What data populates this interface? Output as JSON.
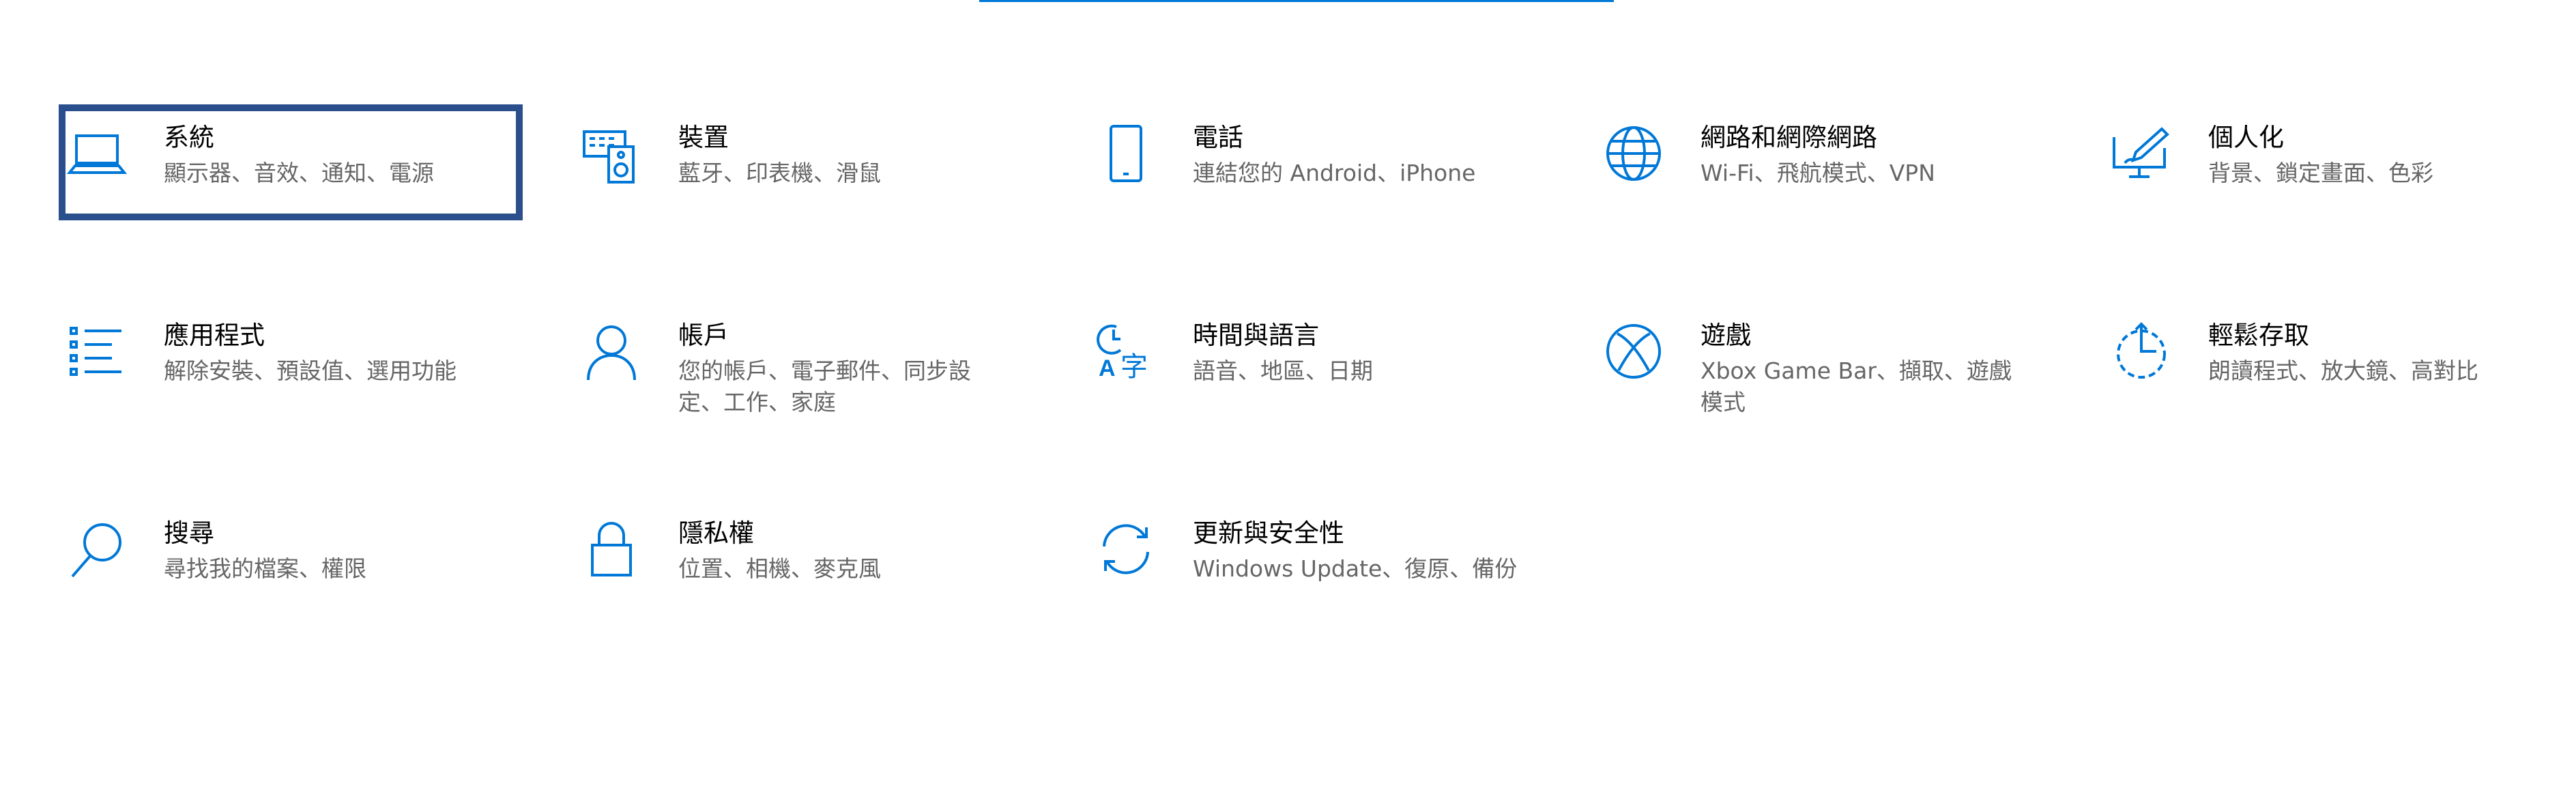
{
  "accent_color": "#0078d7",
  "selected_outline_color": "#2b4f8c",
  "tiles": [
    {
      "title": "系統",
      "desc": "顯示器、音效、通知、電源",
      "icon": "laptop-icon"
    },
    {
      "title": "裝置",
      "desc": "藍牙、印表機、滑鼠",
      "icon": "devices-icon"
    },
    {
      "title": "電話",
      "desc": "連結您的 Android、iPhone",
      "icon": "phone-icon"
    },
    {
      "title": "網路和網際網路",
      "desc": "Wi-Fi、飛航模式、VPN",
      "icon": "globe-icon"
    },
    {
      "title": "個人化",
      "desc": "背景、鎖定畫面、色彩",
      "icon": "personalization-icon"
    },
    {
      "title": "應用程式",
      "desc": "解除安裝、預設值、選用功能",
      "icon": "apps-list-icon"
    },
    {
      "title": "帳戶",
      "desc": "您的帳戶、電子郵件、同步設定、工作、家庭",
      "icon": "person-icon"
    },
    {
      "title": "時間與語言",
      "desc": "語音、地區、日期",
      "icon": "time-language-icon"
    },
    {
      "title": "遊戲",
      "desc": "Xbox Game Bar、擷取、遊戲模式",
      "icon": "xbox-icon"
    },
    {
      "title": "輕鬆存取",
      "desc": "朗讀程式、放大鏡、高對比",
      "icon": "ease-of-access-icon"
    },
    {
      "title": "搜尋",
      "desc": "尋找我的檔案、權限",
      "icon": "search-icon"
    },
    {
      "title": "隱私權",
      "desc": "位置、相機、麥克風",
      "icon": "lock-icon"
    },
    {
      "title": "更新與安全性",
      "desc": "Windows Update、復原、備份",
      "icon": "update-icon"
    }
  ]
}
